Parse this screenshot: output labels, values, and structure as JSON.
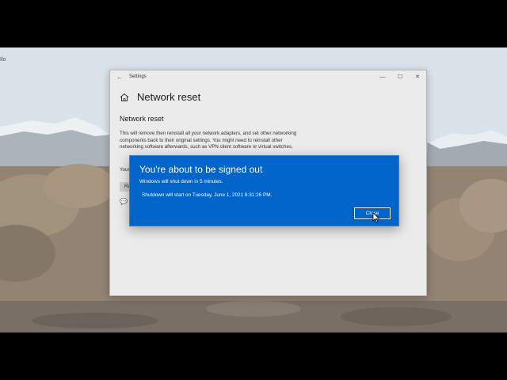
{
  "desktop": {
    "label": "Ilo"
  },
  "settings_window": {
    "title": "Settings",
    "back_glyph": "←",
    "minimize_glyph": "—",
    "maximize_glyph": "☐",
    "close_glyph": "✕",
    "page_title": "Network reset",
    "section_title": "Network reset",
    "description": "This will remove then reinstall all your network adapters, and set other networking components back to their original settings. You might need to reinstall other networking software afterwards, such as VPN client software or virtual switches.",
    "partial_text": "Your",
    "partial_button": "Re",
    "feedback_glyph": "💬"
  },
  "dialog": {
    "title": "You're about to be signed out",
    "message": "Windows will shut down in 5 minutes.",
    "schedule": "Shutdown will start on Tuesday, June 1, 2021 8:31:26 PM.",
    "close_label": "Close"
  },
  "colors": {
    "dialog_background": "#0064c8",
    "settings_background": "#ebebeb"
  },
  "icons": [
    "home-icon",
    "back-arrow-icon",
    "feedback-icon",
    "mouse-cursor-icon"
  ]
}
